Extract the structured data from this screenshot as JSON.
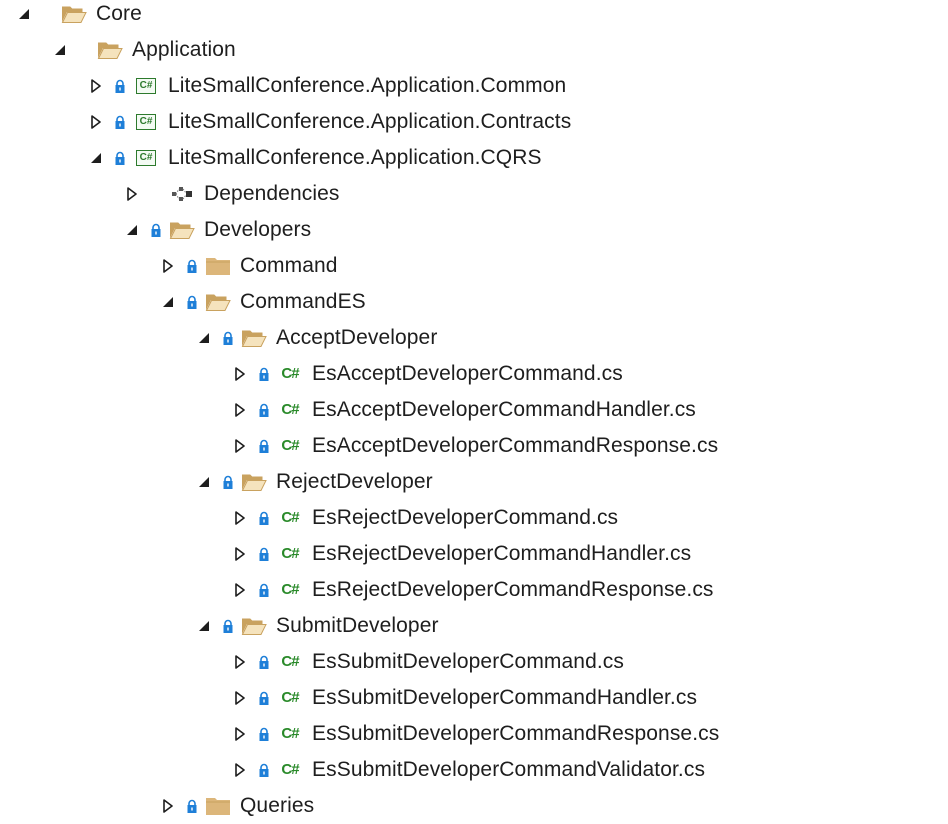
{
  "colors": {
    "folder": "#dcb67a",
    "folder_dark": "#c9a25f",
    "lock": "#1e7fd8",
    "cs_green": "#2a8a2a",
    "expander": "#1e1e1e"
  },
  "tree": [
    {
      "label": "Core",
      "expanded": true,
      "kind": "folder-open",
      "lock": false
    },
    {
      "label": "Application",
      "expanded": true,
      "kind": "folder-open",
      "lock": false
    },
    {
      "label": "LiteSmallConference.Application.Common",
      "expanded": false,
      "kind": "csproj",
      "lock": true
    },
    {
      "label": "LiteSmallConference.Application.Contracts",
      "expanded": false,
      "kind": "csproj",
      "lock": true
    },
    {
      "label": "LiteSmallConference.Application.CQRS",
      "expanded": true,
      "kind": "csproj",
      "lock": true
    },
    {
      "label": "Dependencies",
      "expanded": false,
      "kind": "dependencies",
      "lock": false
    },
    {
      "label": "Developers",
      "expanded": true,
      "kind": "folder-open",
      "lock": true
    },
    {
      "label": "Command",
      "expanded": false,
      "kind": "folder-closed",
      "lock": true
    },
    {
      "label": "CommandES",
      "expanded": true,
      "kind": "folder-open",
      "lock": true
    },
    {
      "label": "AcceptDeveloper",
      "expanded": true,
      "kind": "folder-open",
      "lock": true
    },
    {
      "label": "EsAcceptDeveloperCommand.cs",
      "expanded": false,
      "kind": "csfile",
      "lock": true
    },
    {
      "label": "EsAcceptDeveloperCommandHandler.cs",
      "expanded": false,
      "kind": "csfile",
      "lock": true
    },
    {
      "label": "EsAcceptDeveloperCommandResponse.cs",
      "expanded": false,
      "kind": "csfile",
      "lock": true
    },
    {
      "label": "RejectDeveloper",
      "expanded": true,
      "kind": "folder-open",
      "lock": true
    },
    {
      "label": "EsRejectDeveloperCommand.cs",
      "expanded": false,
      "kind": "csfile",
      "lock": true
    },
    {
      "label": "EsRejectDeveloperCommandHandler.cs",
      "expanded": false,
      "kind": "csfile",
      "lock": true
    },
    {
      "label": "EsRejectDeveloperCommandResponse.cs",
      "expanded": false,
      "kind": "csfile",
      "lock": true
    },
    {
      "label": "SubmitDeveloper",
      "expanded": true,
      "kind": "folder-open",
      "lock": true
    },
    {
      "label": "EsSubmitDeveloperCommand.cs",
      "expanded": false,
      "kind": "csfile",
      "lock": true
    },
    {
      "label": "EsSubmitDeveloperCommandHandler.cs",
      "expanded": false,
      "kind": "csfile",
      "lock": true
    },
    {
      "label": "EsSubmitDeveloperCommandResponse.cs",
      "expanded": false,
      "kind": "csfile",
      "lock": true
    },
    {
      "label": "EsSubmitDeveloperCommandValidator.cs",
      "expanded": false,
      "kind": "csfile",
      "lock": true
    },
    {
      "label": "Queries",
      "expanded": false,
      "kind": "folder-closed",
      "lock": true
    }
  ],
  "icons": {
    "expanded": "expanded-triangle-icon",
    "collapsed": "collapsed-triangle-icon",
    "lock": "lock-icon",
    "folder-open": "folder-open-icon",
    "folder-closed": "folder-icon",
    "csproj": "csharp-project-icon",
    "csfile": "csharp-file-icon",
    "dependencies": "dependencies-icon",
    "csproj_text": "C#",
    "csfile_text": "C#"
  }
}
